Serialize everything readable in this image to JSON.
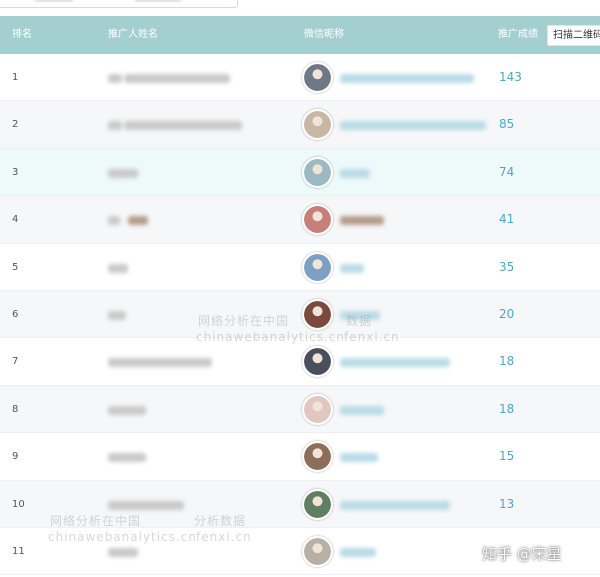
{
  "headers": {
    "rank": "排名",
    "name": "推广人姓名",
    "wechat": "微信昵称",
    "score": "推广成绩",
    "qr_button": "扫描二维码"
  },
  "rows": [
    {
      "rank": "1",
      "score": "143",
      "avatar_color": "#6d7a86"
    },
    {
      "rank": "2",
      "score": "85",
      "avatar_color": "#c9b7a6"
    },
    {
      "rank": "3",
      "score": "74",
      "avatar_color": "#9bb9c2"
    },
    {
      "rank": "4",
      "score": "41",
      "avatar_color": "#c77f7a"
    },
    {
      "rank": "5",
      "score": "35",
      "avatar_color": "#7e9fc4"
    },
    {
      "rank": "6",
      "score": "20",
      "avatar_color": "#7a4b3a"
    },
    {
      "rank": "7",
      "score": "18",
      "avatar_color": "#4a4f5c"
    },
    {
      "rank": "8",
      "score": "18",
      "avatar_color": "#e0c8c0"
    },
    {
      "rank": "9",
      "score": "15",
      "avatar_color": "#8c6e5a"
    },
    {
      "rank": "10",
      "score": "13",
      "avatar_color": "#5f7f63"
    },
    {
      "rank": "11",
      "score": "",
      "avatar_color": "#b8b0a4"
    }
  ],
  "watermarks": [
    {
      "text": "网络分析在中国"
    },
    {
      "text": "chinawebanalytics.cn"
    },
    {
      "text": "数据"
    },
    {
      "text": "fenxi.cn"
    },
    {
      "text": "网络分析在中国"
    },
    {
      "text": "chinawebanalytics.cn"
    },
    {
      "text": "分析数据"
    },
    {
      "text": "fenxi.cn"
    }
  ],
  "credit": "知乎 @宋星"
}
